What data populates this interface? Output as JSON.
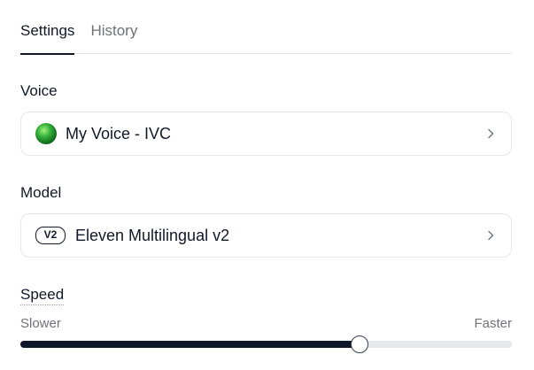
{
  "tabs": [
    {
      "label": "Settings",
      "active": true
    },
    {
      "label": "History",
      "active": false
    }
  ],
  "voice": {
    "section_label": "Voice",
    "selected": "My Voice - IVC",
    "avatar_icon": "voice-avatar-icon"
  },
  "model": {
    "section_label": "Model",
    "badge": "V2",
    "selected": "Eleven Multilingual v2"
  },
  "speed": {
    "section_label": "Speed",
    "min_label": "Slower",
    "max_label": "Faster",
    "value": 0.69
  },
  "colors": {
    "accent": "#0f172a",
    "muted_text": "#71717a",
    "border": "#e5e7eb"
  }
}
